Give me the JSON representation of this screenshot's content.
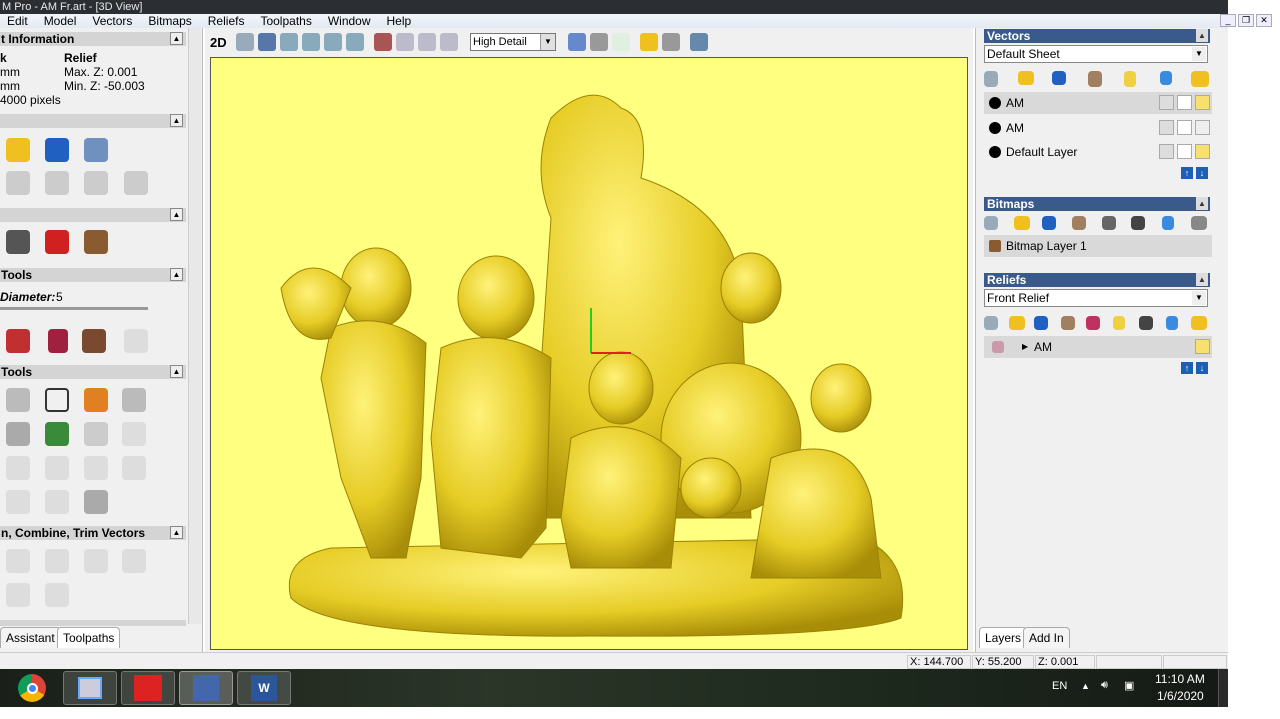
{
  "title": "M Pro - AM Fr.art - [3D View]",
  "menu": [
    "Edit",
    "Model",
    "Vectors",
    "Bitmaps",
    "Reliefs",
    "Toolpaths",
    "Window",
    "Help"
  ],
  "left": {
    "info_header": "t Information",
    "info_col1": [
      "k",
      "mm",
      "mm",
      "4000 pixels"
    ],
    "info_col2": [
      "Relief",
      "Max. Z: 0.001",
      "Min. Z: -50.003"
    ],
    "tools_header_1": "Tools",
    "diameter_label": "Diameter:",
    "diameter_value": "5",
    "tools_header_2": "Tools",
    "combine_header": "n, Combine, Trim Vectors",
    "tabs": [
      "Assistant",
      "Toolpaths"
    ]
  },
  "view": {
    "mode_2d": "2D",
    "detail": "High Detail"
  },
  "right": {
    "vectors": {
      "title": "Vectors",
      "sheet": "Default Sheet",
      "layers": [
        {
          "name": "AM",
          "selected": true,
          "visible": true
        },
        {
          "name": "AM",
          "selected": false,
          "visible": false
        },
        {
          "name": "Default Layer",
          "selected": false,
          "visible": true
        }
      ]
    },
    "bitmaps": {
      "title": "Bitmaps",
      "layers": [
        "Bitmap Layer 1"
      ]
    },
    "reliefs": {
      "title": "Reliefs",
      "relief": "Front Relief",
      "layers": [
        "AM"
      ]
    },
    "tabs": [
      "Layers",
      "Add In"
    ]
  },
  "status": {
    "x": "X: 144.700",
    "y": "Y: 55.200",
    "z": "Z: 0.001"
  },
  "taskbar": {
    "lang": "EN",
    "time": "11:10 AM",
    "date": "1/6/2020"
  },
  "colors": {
    "canvas": "#ffff80",
    "relief": "#e8d020",
    "panel_header": "#3a5a8c"
  }
}
